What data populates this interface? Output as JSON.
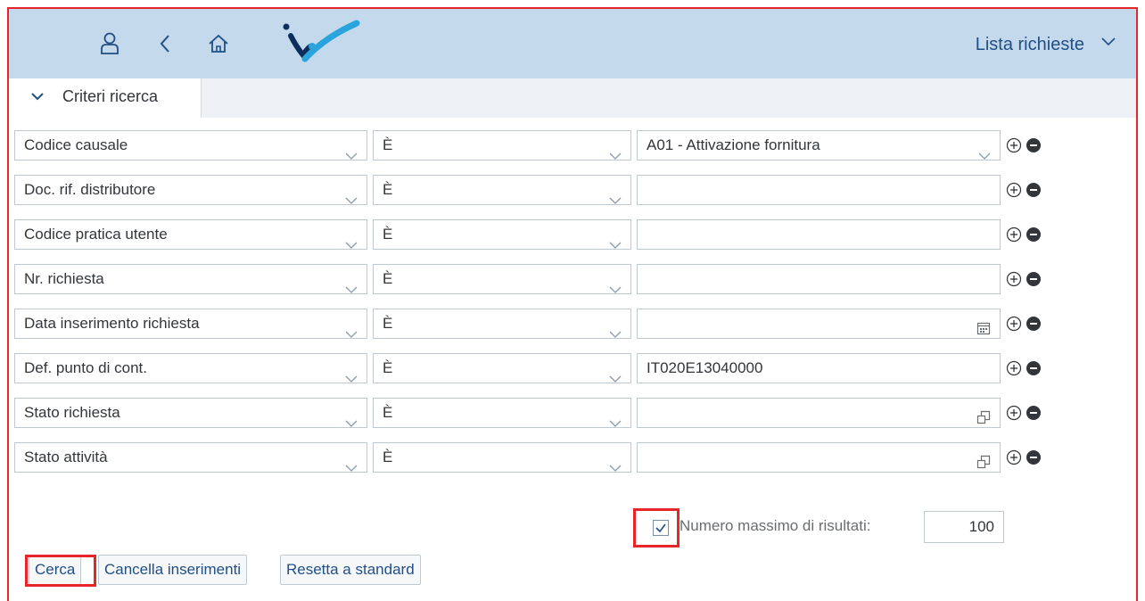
{
  "shell": {
    "title": "Lista richieste",
    "icons": [
      "user-icon",
      "back-icon",
      "home-icon",
      "app-logo"
    ],
    "accent_color": "#1f4f86",
    "bar_color": "#c5d9ec"
  },
  "criteria": {
    "panel_label": "Criteri ricerca",
    "rows": [
      {
        "field": "Codice causale",
        "operator": "È",
        "value": "A01 - Attivazione fornitura",
        "value_help": "dropdown"
      },
      {
        "field": "Doc. rif. distributore",
        "operator": "È",
        "value": "",
        "value_help": "none"
      },
      {
        "field": "Codice pratica utente",
        "operator": "È",
        "value": "",
        "value_help": "none"
      },
      {
        "field": "Nr. richiesta",
        "operator": "È",
        "value": "",
        "value_help": "none"
      },
      {
        "field": "Data inserimento richiesta",
        "operator": "È",
        "value": "",
        "value_help": "calendar"
      },
      {
        "field": "Def. punto di cont.",
        "operator": "È",
        "value": "IT020E13040000",
        "value_help": "none"
      },
      {
        "field": "Stato richiesta",
        "operator": "È",
        "value": "",
        "value_help": "value-help"
      },
      {
        "field": "Stato attività",
        "operator": "È",
        "value": "",
        "value_help": "value-help"
      }
    ]
  },
  "max_results": {
    "label": "Numero massimo di risultati:",
    "checked": true,
    "value": "100"
  },
  "buttons": {
    "search": "Cerca",
    "clear": "Cancella inserimenti",
    "reset": "Resetta a standard"
  },
  "highlight_color": "#e8262a"
}
